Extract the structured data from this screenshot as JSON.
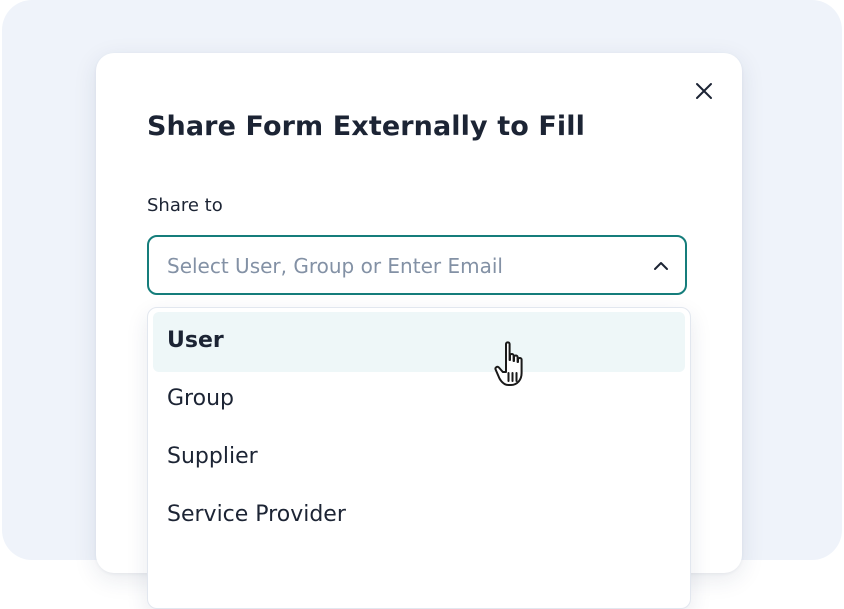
{
  "dialog": {
    "title": "Share Form Externally to Fill",
    "close_icon": "close-icon"
  },
  "share_to": {
    "label": "Share to",
    "placeholder": "Select User, Group or Enter Email",
    "chevron_icon": "chevron-up-icon",
    "expanded": true
  },
  "dropdown": {
    "options": [
      {
        "label": "User",
        "highlighted": true
      },
      {
        "label": "Group"
      },
      {
        "label": "Supplier"
      },
      {
        "label": "Service Provider"
      }
    ]
  },
  "colors": {
    "accent": "#157d7b",
    "title_text": "#1c2434",
    "placeholder_text": "#8391a5",
    "highlight_bg": "#eef7f8",
    "backdrop": "#eff3fa"
  },
  "cursor": {
    "icon": "hand-pointer-icon"
  }
}
